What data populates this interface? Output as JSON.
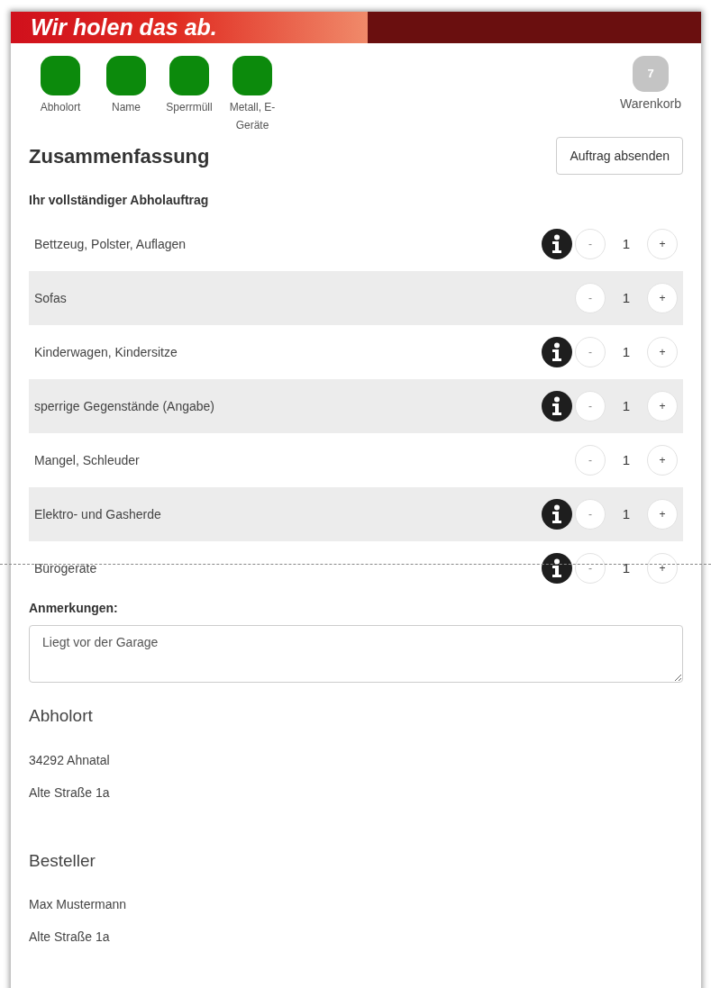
{
  "header": {
    "slogan": "Wir holen das ab."
  },
  "steps": [
    {
      "label": "Abholort",
      "completed": true
    },
    {
      "label": "Name",
      "completed": true
    },
    {
      "label": "Sperrmüll",
      "completed": true
    },
    {
      "label": "Metall, E-Geräte",
      "completed": true
    }
  ],
  "cart": {
    "count": "7",
    "label": "Warenkorb"
  },
  "summary": {
    "title": "Zusammenfassung",
    "submit": "Auftrag absenden",
    "subtitle": "Ihr vollständiger Abholauftrag"
  },
  "items": [
    {
      "name": "Bettzeug, Polster, Auflagen",
      "info": true,
      "minus": "-",
      "quantity": "1",
      "plus": "+"
    },
    {
      "name": "Sofas",
      "info": false,
      "minus": "-",
      "quantity": "1",
      "plus": "+"
    },
    {
      "name": "Kinderwagen, Kindersitze",
      "info": true,
      "minus": "-",
      "quantity": "1",
      "plus": "+"
    },
    {
      "name": "sperrige Gegenstände (Angabe)",
      "info": true,
      "minus": "-",
      "quantity": "1",
      "plus": "+"
    },
    {
      "name": "Mangel, Schleuder",
      "info": false,
      "minus": "-",
      "quantity": "1",
      "plus": "+"
    },
    {
      "name": "Elektro- und Gasherde",
      "info": true,
      "minus": "-",
      "quantity": "1",
      "plus": "+"
    },
    {
      "name": "Bürogeräte",
      "info": true,
      "minus": "-",
      "quantity": "1",
      "plus": "+"
    }
  ],
  "notes": {
    "label": "Anmerkungen:",
    "value": "Liegt vor der Garage"
  },
  "sections": [
    {
      "title": "Abholort",
      "lines": [
        "34292 Ahnatal",
        "Alte Straße 1a"
      ]
    },
    {
      "title": "Besteller",
      "lines": [
        "Max Mustermann",
        "Alte Straße 1a"
      ]
    }
  ]
}
